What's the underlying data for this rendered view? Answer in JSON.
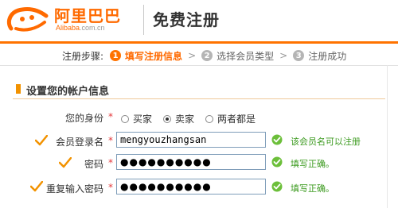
{
  "header": {
    "logo_cn": "阿里巴巴",
    "logo_en": "Alibaba",
    "logo_domain": ".com.cn",
    "title": "免费注册"
  },
  "steps": {
    "label": "注册步骤:",
    "items": [
      {
        "num": "1",
        "label": "填写注册信息",
        "active": true
      },
      {
        "num": "2",
        "label": "选择会员类型",
        "active": false
      },
      {
        "num": "3",
        "label": "注册成功",
        "active": false
      }
    ],
    "separator": ">"
  },
  "section": {
    "title": "设置您的帐户信息"
  },
  "form": {
    "identity": {
      "label": "您的身份",
      "required_mark": "*",
      "options": [
        {
          "label": "买家",
          "selected": false
        },
        {
          "label": "卖家",
          "selected": true
        },
        {
          "label": "两者都是",
          "selected": false
        }
      ]
    },
    "username": {
      "label": "会员登录名",
      "required_mark": "*",
      "value": "mengyouzhangsan",
      "status": "该会员名可以注册"
    },
    "password": {
      "label": "密码",
      "required_mark": "*",
      "value": "●●●●●●●●●●",
      "status": "填写正确。"
    },
    "confirm_password": {
      "label": "重复输入密码",
      "required_mark": "*",
      "value": "●●●●●●●●●●",
      "status": "填写正确。"
    }
  },
  "colors": {
    "brand_orange": "#ff6a00",
    "success_green": "#3b9a1e",
    "required_red": "#e4393c"
  }
}
